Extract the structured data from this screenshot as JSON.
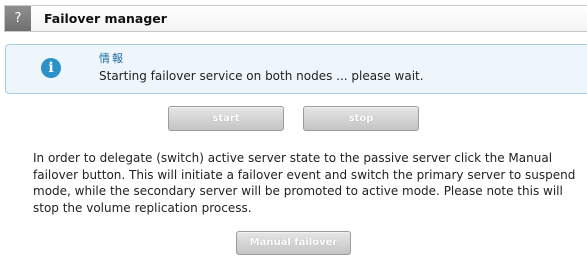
{
  "header": {
    "help_glyph": "?",
    "title": "Failover manager"
  },
  "info": {
    "icon": "info-icon",
    "icon_glyph": "i",
    "title": "情報",
    "message": "Starting failover service on both nodes ... please wait."
  },
  "controls": {
    "start_label": "start",
    "stop_label": "stop"
  },
  "description": "In order to delegate (switch) active server state to the passive server click the Manual failover button. This will initiate a failover event and switch the primary server to suspend mode, while the secondary server will be promoted to active mode. Please note this will stop the volume replication process.",
  "manual": {
    "button_label": "Manual failover"
  },
  "colors": {
    "info_background": "#eef6fb",
    "info_border": "#a9cde3",
    "info_icon": "#2a91c9",
    "button_face": "#d4d4d4"
  }
}
